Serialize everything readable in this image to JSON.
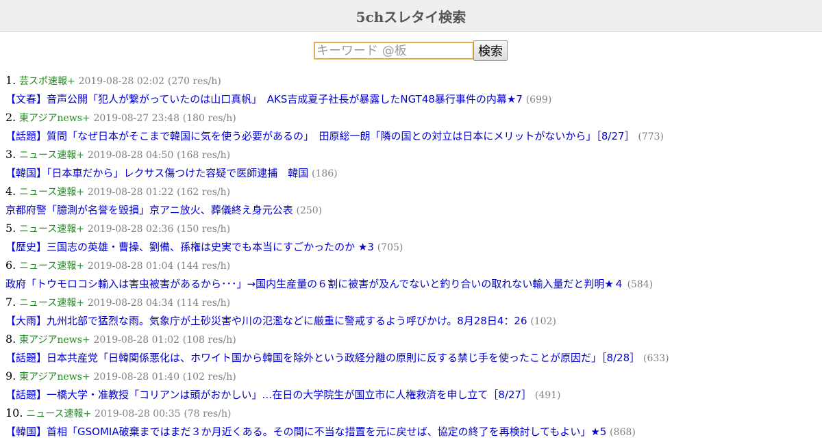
{
  "header": {
    "title": "5chスレタイ検索"
  },
  "search": {
    "placeholder": "キーワード @板",
    "button_label": "検索"
  },
  "results": [
    {
      "rank": "1.",
      "board": "芸スポ速報+",
      "date": "2019-08-28 02:02",
      "rate": "(270 res/h)",
      "title": "【文春】音声公開「犯人が繋がっていたのは山口真帆」　AKS吉成夏子社長が暴露したNGT48暴行事件の内幕★7",
      "count": "(699)"
    },
    {
      "rank": "2.",
      "board": "東アジアnews+",
      "date": "2019-08-27 23:48",
      "rate": "(180 res/h)",
      "title": "【話題】質問「なぜ日本がそこまで韓国に気を使う必要があるの」　田原総一朗「隣の国との対立は日本にメリットがないから」［8/27］",
      "count": "(773)"
    },
    {
      "rank": "3.",
      "board": "ニュース速報+",
      "date": "2019-08-28 04:50",
      "rate": "(168 res/h)",
      "title": "【韓国】「日本車だから」レクサス傷つけた容疑で医師逮捕　韓国",
      "count": "(186)"
    },
    {
      "rank": "4.",
      "board": "ニュース速報+",
      "date": "2019-08-28 01:22",
      "rate": "(162 res/h)",
      "title": "京都府警「臆測が名誉を毀損」京アニ放火、葬儀終え身元公表",
      "count": "(250)"
    },
    {
      "rank": "5.",
      "board": "ニュース速報+",
      "date": "2019-08-28 02:36",
      "rate": "(150 res/h)",
      "title": "【歴史】三国志の英雄・曹操、劉備、孫権は史実でも本当にすごかったのか ★3",
      "count": "(705)"
    },
    {
      "rank": "6.",
      "board": "ニュース速報+",
      "date": "2019-08-28 01:04",
      "rate": "(144 res/h)",
      "title": "政府「トウモロコシ輸入は害虫被害があるから･･･」→国内生産量の６割に被害が及んでないと釣り合いの取れない輸入量だと判明★４",
      "count": "(584)"
    },
    {
      "rank": "7.",
      "board": "ニュース速報+",
      "date": "2019-08-28 04:34",
      "rate": "(114 res/h)",
      "title": "【大雨】九州北部で猛烈な雨。気象庁が土砂災害や川の氾濫などに厳重に警戒するよう呼びかけ。8月28日4：26",
      "count": "(102)"
    },
    {
      "rank": "8.",
      "board": "東アジアnews+",
      "date": "2019-08-28 01:02",
      "rate": "(108 res/h)",
      "title": "【話題】日本共産党「日韓関係悪化は、ホワイト国から韓国を除外という政経分離の原則に反する禁じ手を使ったことが原因だ」［8/28］",
      "count": "(633)"
    },
    {
      "rank": "9.",
      "board": "東アジアnews+",
      "date": "2019-08-28 01:40",
      "rate": "(102 res/h)",
      "title": "【話題】一橋大学・准教授「コリアンは頭がおかしい」…在日の大学院生が国立市に人権救済を申し立て［8/27］",
      "count": "(491)"
    },
    {
      "rank": "10.",
      "board": "ニュース速報+",
      "date": "2019-08-28 00:35",
      "rate": "(78 res/h)",
      "title": "【韓国】首相「GSOMIA破棄まではまだ３か月近くある。その間に不当な措置を元に戻せば、協定の終了を再検討してもよい」★5",
      "count": "(868)"
    }
  ]
}
